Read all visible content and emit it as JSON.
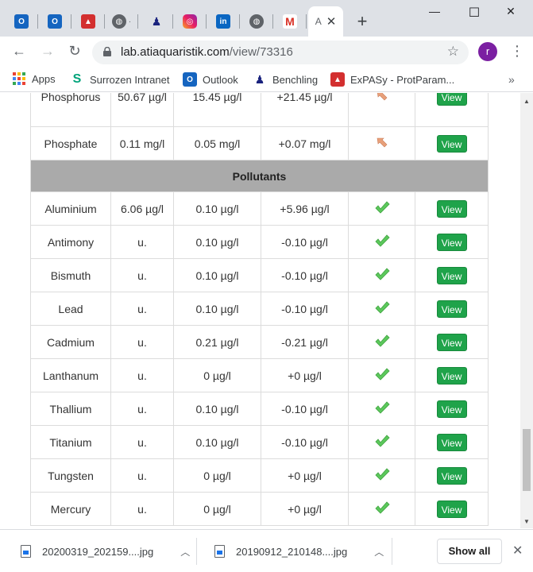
{
  "browser": {
    "tabs": [
      {
        "icon": "outlook-icon"
      },
      {
        "icon": "outlook-icon"
      },
      {
        "icon": "pdf-icon"
      },
      {
        "icon": "globe-icon",
        "extra": "·"
      },
      {
        "icon": "benchling-icon"
      },
      {
        "icon": "instagram-icon"
      },
      {
        "icon": "linkedin-icon"
      },
      {
        "icon": "globe-icon"
      },
      {
        "icon": "gmail-icon",
        "glyph": "M"
      },
      {
        "icon": "page-icon",
        "active": true,
        "glyph": "A"
      }
    ],
    "new_tab": "+",
    "window_controls": {
      "minimize": "—",
      "maximize": "☐",
      "close": "✕"
    },
    "url_host": "lab.atiaquaristik.com",
    "url_path": "/view/73316",
    "profile_initial": "r"
  },
  "bookmarks": [
    {
      "label": "Apps",
      "icon": "apps-grid-icon"
    },
    {
      "label": "Surrozen Intranet",
      "icon": "surrozen-icon"
    },
    {
      "label": "Outlook",
      "icon": "outlook-icon"
    },
    {
      "label": "Benchling",
      "icon": "benchling-icon"
    },
    {
      "label": "ExPASy - ProtParam...",
      "icon": "expasy-icon"
    }
  ],
  "table": {
    "top_rows": [
      {
        "name": "Phosphorus",
        "measured": "50.67 µg/l",
        "target": "15.45 µg/l",
        "diff": "+21.45 µg/l",
        "status": "low-arrow",
        "action": "View"
      },
      {
        "name": "Phosphate",
        "measured": "0.11 mg/l",
        "target": "0.05 mg/l",
        "diff": "+0.07 mg/l",
        "status": "low-arrow",
        "action": "View"
      }
    ],
    "section_title": "Pollutants",
    "rows": [
      {
        "name": "Aluminium",
        "measured": "6.06 µg/l",
        "target": "0.10 µg/l",
        "diff": "+5.96 µg/l",
        "action": "View"
      },
      {
        "name": "Antimony",
        "measured": "u.",
        "target": "0.10 µg/l",
        "diff": "-0.10 µg/l",
        "action": "View"
      },
      {
        "name": "Bismuth",
        "measured": "u.",
        "target": "0.10 µg/l",
        "diff": "-0.10 µg/l",
        "action": "View"
      },
      {
        "name": "Lead",
        "measured": "u.",
        "target": "0.10 µg/l",
        "diff": "-0.10 µg/l",
        "action": "View"
      },
      {
        "name": "Cadmium",
        "measured": "u.",
        "target": "0.21 µg/l",
        "diff": "-0.21 µg/l",
        "action": "View"
      },
      {
        "name": "Lanthanum",
        "measured": "u.",
        "target": "0 µg/l",
        "diff": "+0 µg/l",
        "action": "View"
      },
      {
        "name": "Thallium",
        "measured": "u.",
        "target": "0.10 µg/l",
        "diff": "-0.10 µg/l",
        "action": "View"
      },
      {
        "name": "Titanium",
        "measured": "u.",
        "target": "0.10 µg/l",
        "diff": "-0.10 µg/l",
        "action": "View"
      },
      {
        "name": "Tungsten",
        "measured": "u.",
        "target": "0 µg/l",
        "diff": "+0 µg/l",
        "action": "View"
      },
      {
        "name": "Mercury",
        "measured": "u.",
        "target": "0 µg/l",
        "diff": "+0 µg/l",
        "action": "View"
      }
    ]
  },
  "downloads": [
    {
      "filename": "20200319_202159....jpg"
    },
    {
      "filename": "20190912_210148....jpg"
    }
  ],
  "show_all_label": "Show all",
  "colors": {
    "view_button": "#1fa34a",
    "check": "#5cc85c",
    "section_header": "#aaaaaa"
  }
}
